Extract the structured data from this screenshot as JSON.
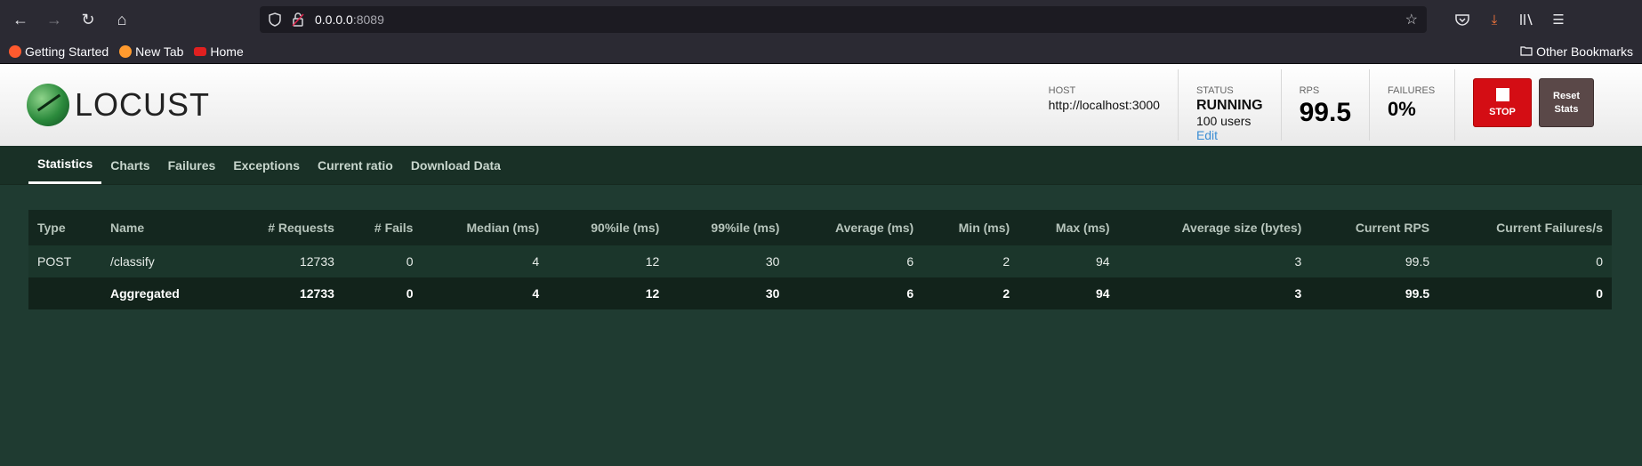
{
  "browser": {
    "url_host": "0.0.0.0",
    "url_port": ":8089",
    "bookmarks": [
      {
        "label": "Getting Started",
        "color": "#ff5a2e"
      },
      {
        "label": "New Tab",
        "color": "#ff9a2e"
      },
      {
        "label": "Home",
        "color": "#e02020"
      }
    ],
    "other_bookmarks": "Other Bookmarks"
  },
  "header": {
    "logo_text": "LOCUST",
    "host_label": "HOST",
    "host_value": "http://localhost:3000",
    "status_label": "STATUS",
    "status_value": "RUNNING",
    "users_value": "100 users",
    "edit_label": "Edit",
    "rps_label": "RPS",
    "rps_value": "99.5",
    "failures_label": "FAILURES",
    "failures_value": "0%",
    "stop_label": "STOP",
    "reset_label": "Reset Stats"
  },
  "tabs": [
    {
      "label": "Statistics",
      "active": true
    },
    {
      "label": "Charts"
    },
    {
      "label": "Failures"
    },
    {
      "label": "Exceptions"
    },
    {
      "label": "Current ratio"
    },
    {
      "label": "Download Data"
    }
  ],
  "table": {
    "headers": [
      "Type",
      "Name",
      "# Requests",
      "# Fails",
      "Median (ms)",
      "90%ile (ms)",
      "99%ile (ms)",
      "Average (ms)",
      "Min (ms)",
      "Max (ms)",
      "Average size (bytes)",
      "Current RPS",
      "Current Failures/s"
    ],
    "rows": [
      [
        "POST",
        "/classify",
        "12733",
        "0",
        "4",
        "12",
        "30",
        "6",
        "2",
        "94",
        "3",
        "99.5",
        "0"
      ]
    ],
    "aggregated": [
      "",
      "Aggregated",
      "12733",
      "0",
      "4",
      "12",
      "30",
      "6",
      "2",
      "94",
      "3",
      "99.5",
      "0"
    ]
  },
  "colors": {
    "accent_stop": "#d40d14",
    "reset_button": "#5a4848",
    "page_background": "#1f3b31"
  }
}
